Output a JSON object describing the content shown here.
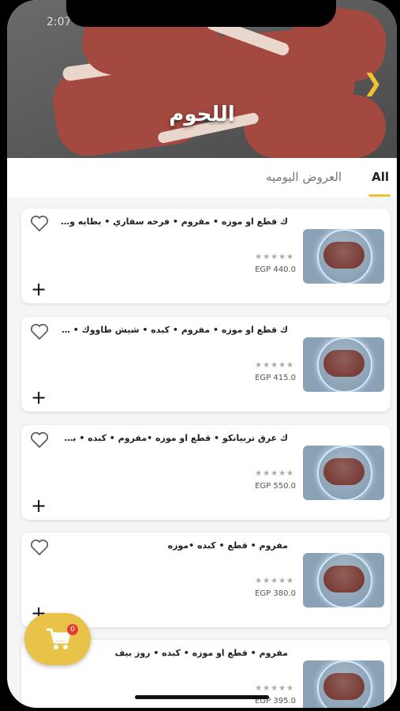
{
  "status": {
    "time": "2:07"
  },
  "hero": {
    "title": "اللحوم",
    "next_icon": "chevron-right-icon"
  },
  "tabs": {
    "all": "All",
    "offers": "العروض اليوميه"
  },
  "products": [
    {
      "title": "ك قطع او موزه • مفروم • فرخه سفاري • بطايه وزن ...",
      "price": "EGP 440.0"
    },
    {
      "title": "ك قطع او موزه • مفروم • كبده • شيش طاووك • حشو...",
      "price": "EGP 415.0"
    },
    {
      "title": "ك عرق تربيانكو • قطع او موزه •مفروم • كبده • بطايه ...",
      "price": "EGP 550.0"
    },
    {
      "title": "مفروم • قطع • كبده •موزه",
      "price": "EGP 380.0"
    },
    {
      "title": "مفروم • قطع او موزه • كبده • روز بيف",
      "price": "EGP 395.0"
    }
  ],
  "rating_stars": "★★★★★",
  "plus_symbol": "+",
  "cart": {
    "badge": "0",
    "icon": "cart-icon"
  },
  "colors": {
    "accent": "#f1c232",
    "fab": "#e9c347",
    "badge": "#e53935"
  }
}
